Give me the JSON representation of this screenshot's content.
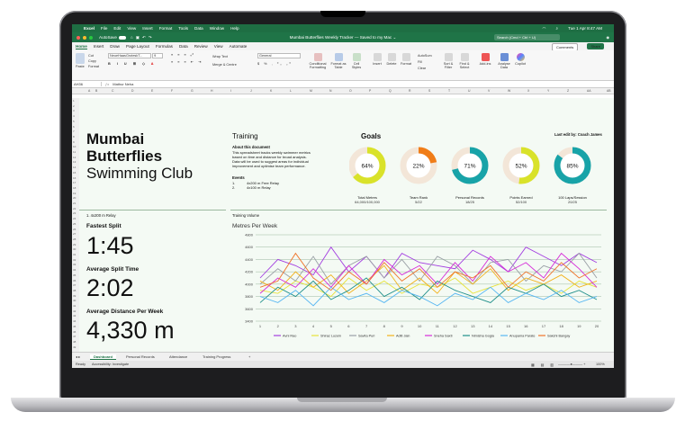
{
  "menubar": {
    "app": "Excel",
    "items": [
      "File",
      "Edit",
      "View",
      "Insert",
      "Format",
      "Tools",
      "Data",
      "Window",
      "Help"
    ],
    "clock": "Tue 1 Apr 8:47 AM"
  },
  "titlebar": {
    "autosave": "AutoSave",
    "title": "Mumbai Butterflies Weekly Tracker — Saved to my Mac ⌄",
    "search_placeholder": "Search (Cmd + Ctrl + U)"
  },
  "ribbon_tabs": [
    "Home",
    "Insert",
    "Draw",
    "Page Layout",
    "Formulas",
    "Data",
    "Review",
    "View",
    "Automate"
  ],
  "ribbon": {
    "comments": "Comments",
    "share": "Share",
    "paste": "Paste",
    "cut": "Cut",
    "copy": "Copy",
    "format": "Format",
    "font_name": "NeueHaasGroteskT...",
    "font_size": "9",
    "wrap": "Wrap Text",
    "merge": "Merge & Centre",
    "number_format": "General",
    "cond": "Conditional Formatting",
    "fmt_table": "Format as Table",
    "cell_styles": "Cell Styles",
    "insert": "Insert",
    "delete": "Delete",
    "format_cells": "Format",
    "autosum": "AutoSum",
    "fill": "Fill",
    "clear": "Clear",
    "sort": "Sort & Filter",
    "find": "Find & Select",
    "addins": "Add-ins",
    "analyse": "Analyse Data",
    "copilot": "Copilot"
  },
  "formula": {
    "cell": "AH36",
    "value": "Mathur Neha"
  },
  "columns": [
    "A",
    "B",
    "C",
    "D",
    "E",
    "F",
    "G",
    "H",
    "I",
    "J",
    "K",
    "L",
    "M",
    "N",
    "O",
    "P",
    "Q",
    "R",
    "S",
    "T",
    "U",
    "V",
    "W",
    "X",
    "Y",
    "Z",
    "AA",
    "AB"
  ],
  "rows": [
    "1",
    "2",
    "3",
    "4",
    "5",
    "6",
    "7",
    "8",
    "9",
    "10",
    "11",
    "12",
    "13",
    "14",
    "15",
    "16",
    "17",
    "18",
    "19",
    "20",
    "21",
    "22",
    "23",
    "24",
    "25",
    "26",
    "27",
    "28",
    "29",
    "30",
    "31",
    "32",
    "33",
    "34",
    "35",
    "36",
    "37",
    "38",
    "39",
    "40",
    "41",
    "42",
    "43",
    "44",
    "45",
    "46",
    "47",
    "48",
    "49"
  ],
  "header": {
    "title_line1": "Mumbai",
    "title_line2": "Butterflies",
    "title_line3": "Swimming Club"
  },
  "training": {
    "heading": "Training",
    "about_heading": "About this document",
    "about_text": [
      "This spreadsheet tracks weekly swimmer metrics",
      "based on time and distance for broad analysis.",
      "Data will be used to suggest areas for individual",
      "improvement and optimise team performance."
    ],
    "events_heading": "Events",
    "events": [
      {
        "num": "1.",
        "name": "4x200 m Free Relay"
      },
      {
        "num": "2.",
        "name": "4x100 m Relay"
      }
    ]
  },
  "goals": {
    "heading": "Goals",
    "last_edit": "Last edit by: Coach James",
    "items": [
      {
        "label": "Total Metres",
        "value": "64,000/100,000",
        "pct_label": "64%",
        "pct": 0.64,
        "color": "#d9e22a"
      },
      {
        "label": "Team Rank",
        "value": "5/22",
        "pct_label": "22%",
        "pct": 0.22,
        "color": "#f07d18"
      },
      {
        "label": "Personal Records",
        "value": "18/25",
        "pct_label": "71%",
        "pct": 0.71,
        "color": "#18a3a8"
      },
      {
        "label": "Points Earned",
        "value": "52/100",
        "pct_label": "52%",
        "pct": 0.52,
        "color": "#d9e22a"
      },
      {
        "label": "100 Laps/Session",
        "value": "20/25",
        "pct_label": "85%",
        "pct": 0.85,
        "color": "#18a3a8"
      }
    ]
  },
  "relay": {
    "event": "1. 4x200 m Relay",
    "fastest_label": "Fastest Split",
    "fastest_value": "1:45",
    "avg_label": "Average Split Time",
    "avg_value": "2:02",
    "dist_label": "Average Distance Per Week",
    "dist_value": "4,330 m"
  },
  "volume": {
    "heading": "Training Volume"
  },
  "chart_data": {
    "type": "line",
    "title": "Metres Per Week",
    "x": [
      1,
      2,
      3,
      4,
      5,
      6,
      7,
      8,
      9,
      10,
      11,
      12,
      13,
      14,
      15,
      16,
      17,
      18,
      19,
      20
    ],
    "ylim": [
      3400,
      4800
    ],
    "yticks": [
      3400,
      3600,
      3800,
      4000,
      4200,
      4400,
      4600,
      4800
    ],
    "grid": true,
    "legend_position": "bottom",
    "series": [
      {
        "name": "Avni Rao",
        "color": "#a33ee0",
        "values": [
          4100,
          4400,
          4300,
          4150,
          4600,
          4200,
          4450,
          4100,
          4500,
          4350,
          4300,
          4250,
          4550,
          4400,
          4200,
          4600,
          4450,
          4300,
          4500,
          4350
        ]
      },
      {
        "name": "Shiraz Luzein",
        "color": "#e7e33b",
        "values": [
          3900,
          3850,
          4050,
          3950,
          3800,
          4100,
          3900,
          4050,
          3850,
          4000,
          3950,
          4100,
          3850,
          3950,
          4050,
          3900,
          4000,
          3850,
          4050,
          3950
        ]
      },
      {
        "name": "Savita Puri",
        "color": "#9aa0a6",
        "values": [
          4000,
          4250,
          4050,
          4450,
          4000,
          4300,
          4450,
          4100,
          4400,
          4050,
          4450,
          4300,
          4000,
          4350,
          4400,
          4050,
          4300,
          4200,
          4500,
          4100
        ]
      },
      {
        "name": "Aditi Jain",
        "color": "#f2b21b",
        "values": [
          4050,
          3900,
          4200,
          3950,
          4150,
          3850,
          4050,
          4300,
          3900,
          4100,
          3850,
          4200,
          4000,
          4250,
          3900,
          4100,
          4000,
          4150,
          3950,
          4050
        ]
      },
      {
        "name": "Sneha Saxti",
        "color": "#d62ad8",
        "values": [
          3850,
          4100,
          3950,
          4250,
          3950,
          4300,
          4000,
          4400,
          4150,
          4300,
          4000,
          4350,
          4050,
          4450,
          4200,
          4350,
          4100,
          4500,
          4250,
          3950
        ]
      },
      {
        "name": "Nimisha Gogia",
        "color": "#1f8f8a",
        "values": [
          3700,
          3950,
          3800,
          4050,
          3750,
          3900,
          4100,
          3800,
          3950,
          3750,
          4050,
          3900,
          3800,
          3700,
          3950,
          3850,
          4000,
          3800,
          3900,
          3750
        ]
      },
      {
        "name": "Anupama Parate",
        "color": "#56b6f2",
        "values": [
          3800,
          3700,
          3900,
          3650,
          3950,
          3750,
          3850,
          3700,
          3900,
          3800,
          3650,
          3850,
          3750,
          3950,
          3700,
          3850,
          3750,
          3900,
          3700,
          3800
        ]
      },
      {
        "name": "Sakshi Bangay",
        "color": "#f0742a",
        "values": [
          3950,
          4050,
          4500,
          4100,
          3900,
          4200,
          4000,
          4350,
          4050,
          4250,
          3950,
          4200,
          4100,
          4300,
          3950,
          4200,
          4050,
          4350,
          4100,
          4250
        ]
      }
    ]
  },
  "sheet_tabs": [
    "Dashboard",
    "Personal Records",
    "Attendance",
    "Training Progress"
  ],
  "status": {
    "ready": "Ready",
    "accessibility": "Accessibility: Investigate",
    "zoom": "100%"
  }
}
